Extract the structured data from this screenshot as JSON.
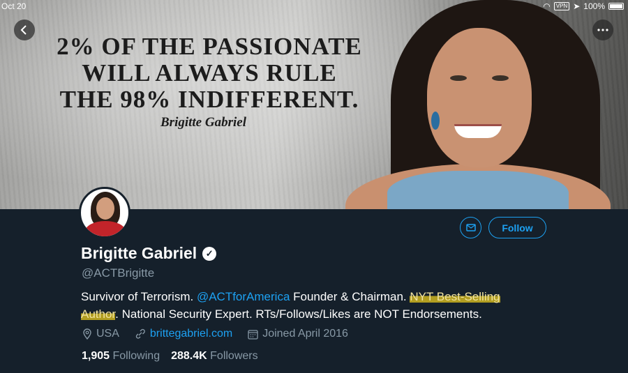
{
  "status_bar": {
    "date": "Oct 20",
    "vpn": "VPN",
    "battery": "100%"
  },
  "banner": {
    "quote_lines": [
      "2% OF THE PASSIONATE",
      "WILL ALWAYS RULE",
      "THE 98% INDIFFERENT."
    ],
    "signature": "Brigitte Gabriel"
  },
  "nav": {
    "back_icon": "chevron-left-icon",
    "more_icon": "more-horizontal-icon"
  },
  "actions": {
    "follow_label": "Follow",
    "message_icon": "mail-icon"
  },
  "profile": {
    "name": "Brigitte Gabriel",
    "handle": "@ACTBrigitte",
    "bio": {
      "part1": "Survivor of Terrorism. ",
      "mention": "@ACTforAmerica",
      "part2": " Founder & Chairman. ",
      "highlight1": "NYT Best-Selling",
      "highlight2": "Author",
      "part3": ". National Security Expert. RTs/Follows/Likes are NOT Endorsements."
    },
    "location": "USA",
    "website": "brittegabriel.com",
    "joined": "Joined April 2016",
    "following_count": "1,905",
    "following_label": "Following",
    "followers_count": "288.4K",
    "followers_label": "Followers"
  },
  "colors": {
    "background": "#15202b",
    "accent": "#1da1f2",
    "muted": "#8899a6",
    "highlight": "#e6c81e"
  }
}
